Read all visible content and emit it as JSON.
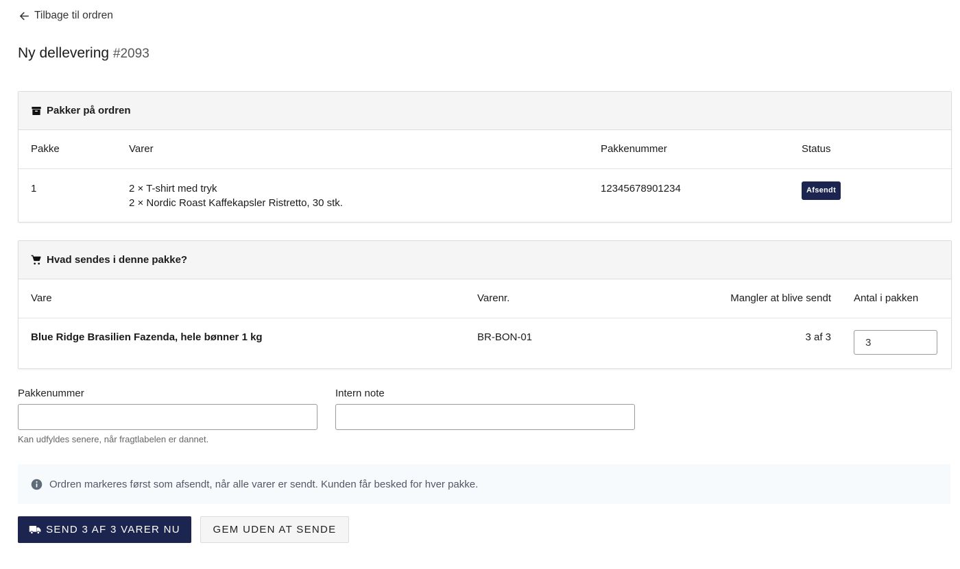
{
  "back_link": {
    "label": "Tilbage til ordren",
    "icon": "arrow-left-icon"
  },
  "title": {
    "text": "Ny dellevering",
    "order_number": "#2093"
  },
  "packages_panel": {
    "heading": "Pakker på ordren",
    "icon": "archive-box-icon",
    "columns": [
      "Pakke",
      "Varer",
      "Pakkenummer",
      "Status"
    ],
    "rows": [
      {
        "pakke": "1",
        "varer": [
          "2 × T-shirt med tryk",
          "2 × Nordic Roast Kaffekapsler Ristretto, 30 stk."
        ],
        "pakkenummer": "12345678901234",
        "status": "Afsendt"
      }
    ]
  },
  "items_panel": {
    "heading": "Hvad sendes i denne pakke?",
    "icon": "cart-icon",
    "columns": [
      "Vare",
      "Varenr.",
      "Mangler at blive sendt",
      "Antal i pakken"
    ],
    "rows": [
      {
        "vare": "Blue Ridge Brasilien Fazenda, hele bønner 1 kg",
        "varenr": "BR-BON-01",
        "mangler": "3 af 3",
        "antal": "3"
      }
    ]
  },
  "form": {
    "pakkenummer_label": "Pakkenummer",
    "pakkenummer_value": "",
    "pakkenummer_hint": "Kan udfyldes senere, når fragtlabelen er dannet.",
    "note_label": "Intern note",
    "note_value": ""
  },
  "info": {
    "icon": "info-icon",
    "text": "Ordren markeres først som afsendt, når alle varer er sendt. Kunden får besked for hver pakke."
  },
  "actions": {
    "send_label": "SEND 3 AF 3 VARER NU",
    "send_icon": "truck-icon",
    "save_label": "GEM UDEN AT SENDE"
  },
  "colors": {
    "primary": "#1c2450",
    "panel_header": "#f5f5f5",
    "info_bg": "#f7fafc"
  }
}
